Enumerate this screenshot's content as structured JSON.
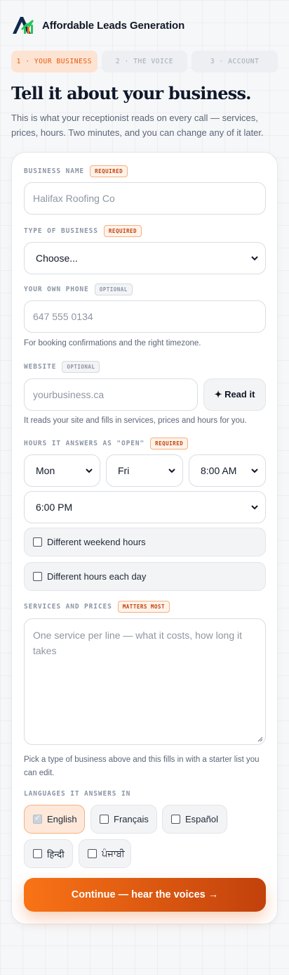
{
  "header": {
    "brand": "Affordable Leads Generation",
    "logo_icon": "mountain-chart-logo-icon"
  },
  "steps": [
    {
      "label": "1 · YOUR BUSINESS",
      "active": true
    },
    {
      "label": "2 · THE VOICE",
      "active": false
    },
    {
      "label": "3 · ACCOUNT",
      "active": false
    }
  ],
  "page": {
    "title": "Tell it about your business.",
    "subtitle": "This is what your receptionist reads on every call — services, prices, hours. Two minutes, and you can change any of it later."
  },
  "form": {
    "business_name": {
      "label": "BUSINESS NAME",
      "badge": "REQUIRED",
      "placeholder": "Halifax Roofing Co"
    },
    "business_type": {
      "label": "TYPE OF BUSINESS",
      "badge": "REQUIRED",
      "value": "Choose..."
    },
    "phone": {
      "label": "YOUR OWN PHONE",
      "badge": "OPTIONAL",
      "placeholder": "647 555 0134",
      "help": "For booking confirmations and the right timezone."
    },
    "website": {
      "label": "WEBSITE",
      "badge": "OPTIONAL",
      "placeholder": "yourbusiness.ca",
      "button": "✦ Read it",
      "help": "It reads your site and fills in services, prices and hours for you."
    },
    "hours": {
      "label": "HOURS IT ANSWERS AS \"OPEN\"",
      "badge": "REQUIRED",
      "from_day": "Mon",
      "to_day": "Fri",
      "open_time": "8:00 AM",
      "close_time": "6:00 PM",
      "weekend_option": "Different weekend hours",
      "each_day_option": "Different hours each day"
    },
    "services": {
      "label": "SERVICES AND PRICES",
      "badge": "MATTERS MOST",
      "placeholder": "One service per line — what it costs, how long it takes",
      "help": "Pick a type of business above and this fills in with a starter list you can edit."
    },
    "languages": {
      "label": "LANGUAGES IT ANSWERS IN",
      "options": [
        {
          "label": "English",
          "checked": true
        },
        {
          "label": "Français",
          "checked": false
        },
        {
          "label": "Español",
          "checked": false
        },
        {
          "label": "हिन्दी",
          "checked": false
        },
        {
          "label": "ਪੰਜਾਬੀ",
          "checked": false
        }
      ]
    },
    "submit": "Continue — hear the voices →"
  },
  "colors": {
    "accent": "#ea580c",
    "accent_light": "#fde3d2",
    "text": "#0f172a"
  }
}
